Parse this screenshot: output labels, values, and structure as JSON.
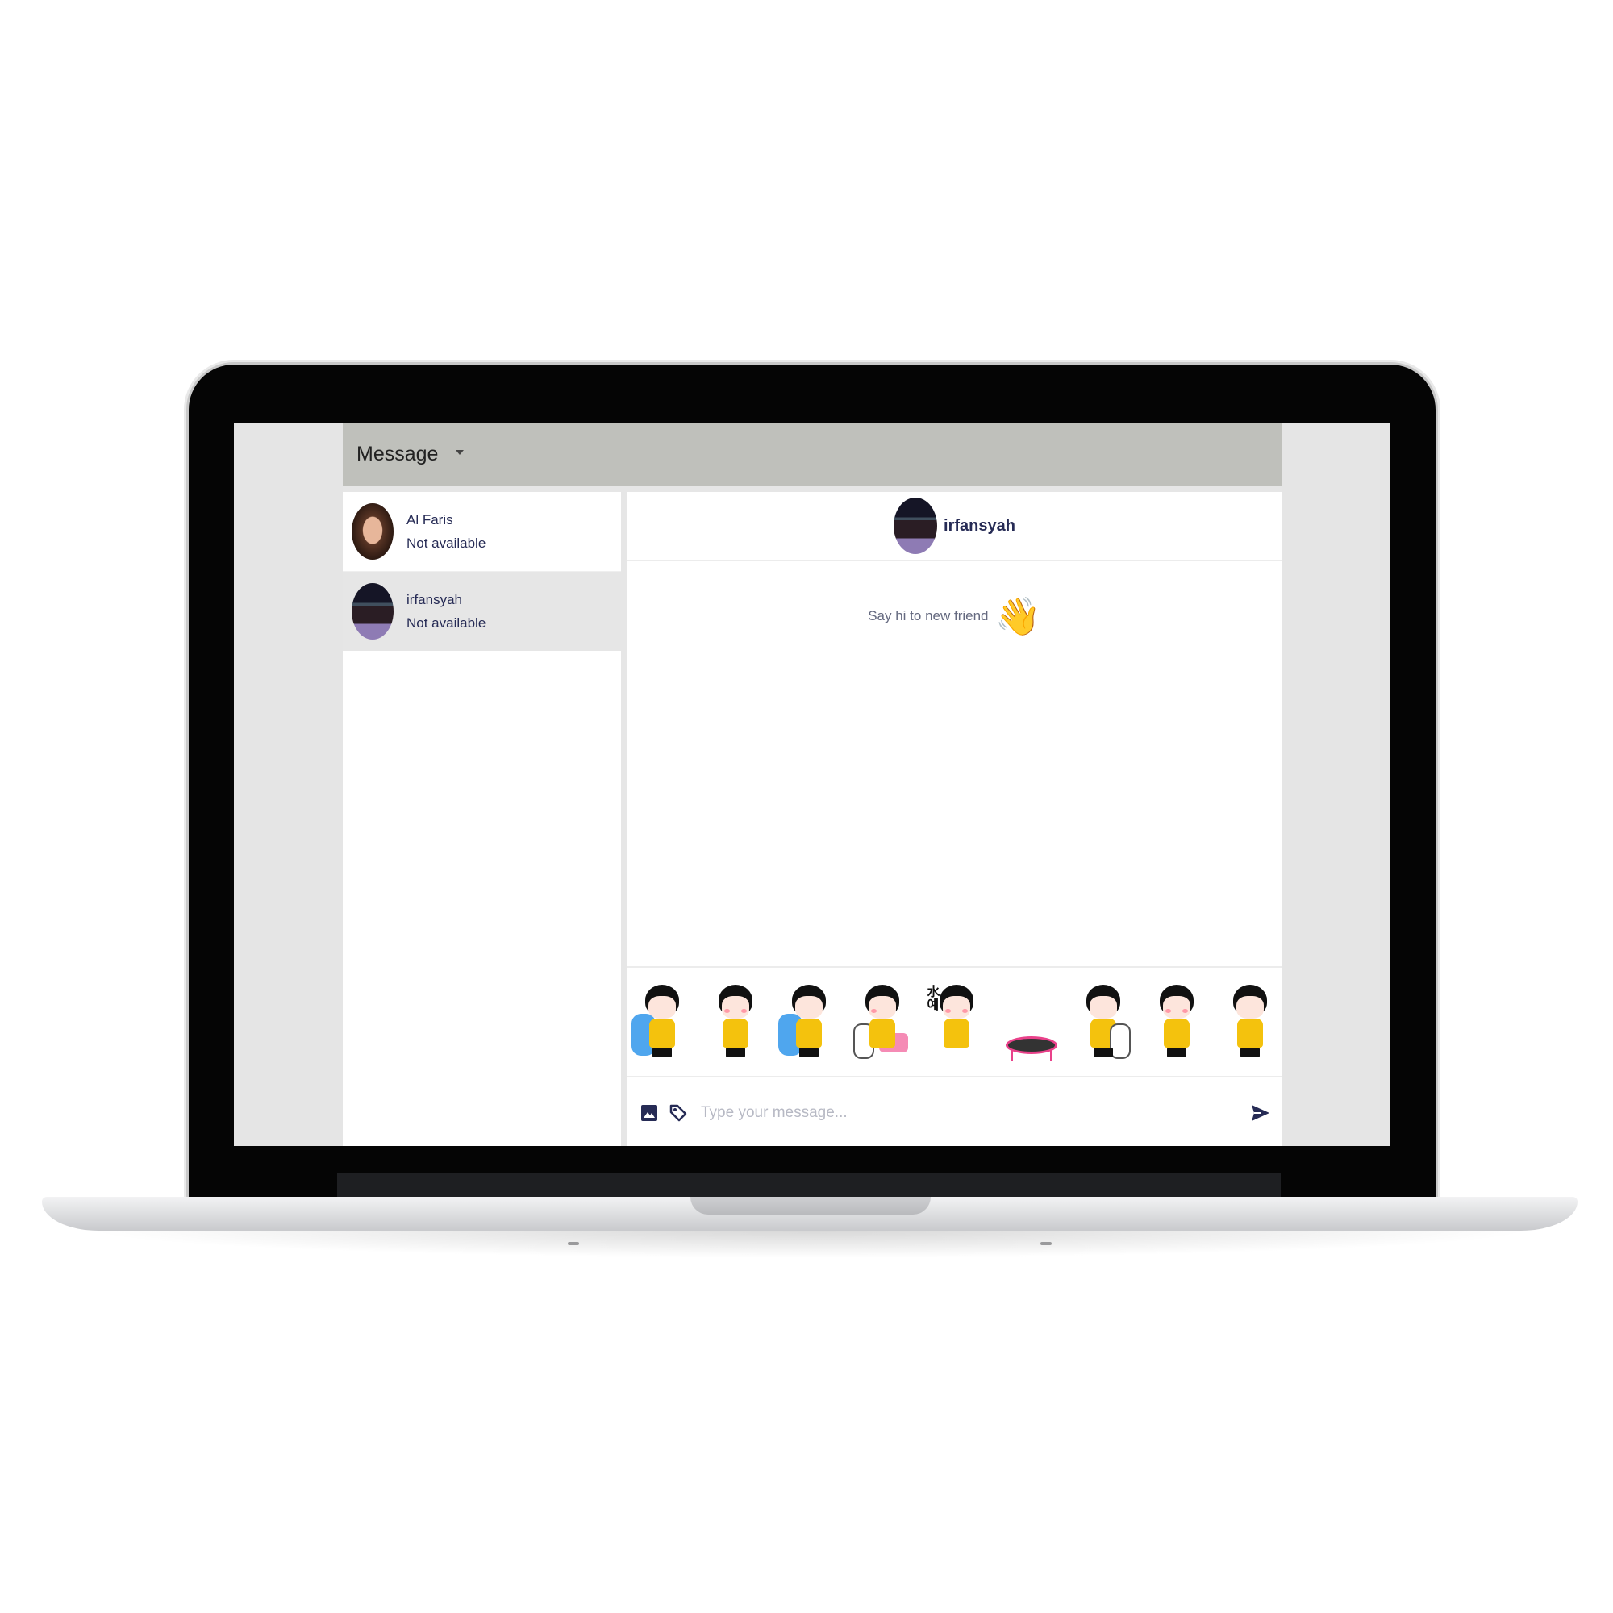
{
  "header": {
    "title": "Message"
  },
  "contacts": [
    {
      "name": "Al Faris",
      "status": "Not available"
    },
    {
      "name": "irfansyah",
      "status": "Not available"
    }
  ],
  "chat": {
    "name": "irfansyah",
    "greeting": "Say hi to new friend",
    "greeting_emoji": "👋"
  },
  "stickers": [
    "sticker-girl-crying-with-cat",
    "sticker-girl-standing",
    "sticker-girl-crying-with-cat-2",
    "sticker-girl-with-cat-pink-blanket",
    "sticker-girl-korean-text",
    "sticker-trampoline",
    "sticker-girl-with-white-cat",
    "sticker-girl-sitting",
    "sticker-girl-shouting"
  ],
  "sticker_text": "水예",
  "composer": {
    "placeholder": "Type your message...",
    "image_icon": "image-icon",
    "tag_icon": "tag-icon",
    "send_icon": "send-icon"
  },
  "colors": {
    "header_bg": "#bfc0bb",
    "accent_text": "#262b55",
    "active_contact_bg": "#e6e6e6"
  }
}
